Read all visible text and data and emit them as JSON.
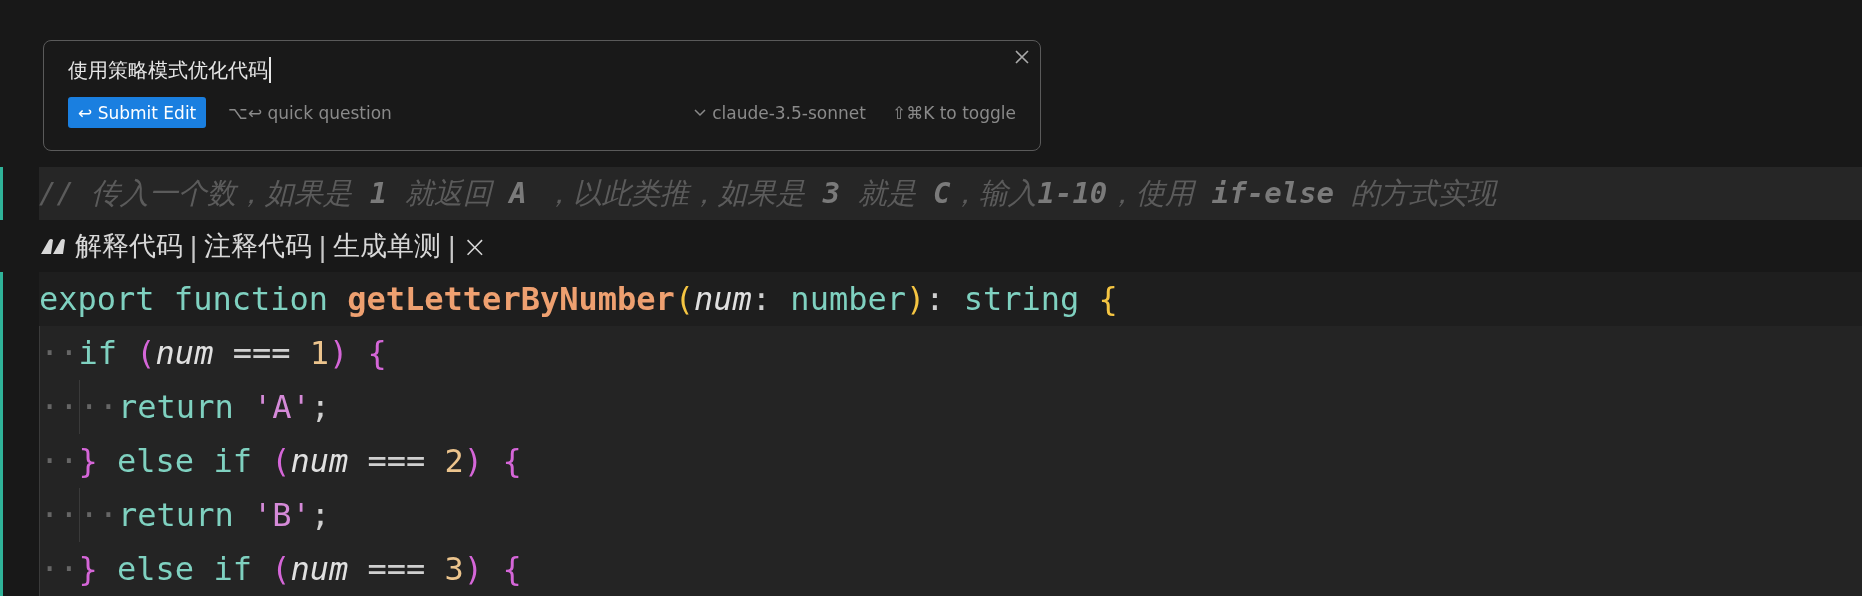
{
  "prompt_box": {
    "value": "使用策略模式优化代码",
    "submit_button": {
      "icon": "↩",
      "label": "Submit Edit"
    },
    "quick_question": "⌥↩ quick question",
    "model": "claude-3.5-sonnet",
    "toggle_hint": "⇧⌘K to toggle"
  },
  "comment_line": "// 传入一个数，如果是 **1** 就返回 **A** ，以此类推，如果是 **3** 就是 **C**，输入**1-10**，使用 **if-else** 的方式实现",
  "codelens": [
    {
      "kind": "action",
      "text": "解释代码"
    },
    {
      "kind": "separator",
      "text": "|"
    },
    {
      "kind": "action",
      "text": "注释代码"
    },
    {
      "kind": "separator",
      "text": "|"
    },
    {
      "kind": "action",
      "text": "生成单测"
    },
    {
      "kind": "separator",
      "text": "|"
    },
    {
      "kind": "close",
      "text": "×"
    }
  ],
  "code_lines": [
    [
      {
        "kind": "keyword",
        "text": "export function "
      },
      {
        "kind": "function",
        "text": "getLetterByNumber"
      },
      {
        "kind": "bracket1",
        "text": "("
      },
      {
        "kind": "param",
        "text": "num"
      },
      {
        "kind": "plain",
        "text": ": "
      },
      {
        "kind": "keyword",
        "text": "number"
      },
      {
        "kind": "bracket1",
        "text": ")"
      },
      {
        "kind": "plain",
        "text": ": "
      },
      {
        "kind": "keyword",
        "text": "string "
      },
      {
        "kind": "bracket1",
        "text": "{"
      }
    ],
    [
      {
        "kind": "ws",
        "text": "··"
      },
      {
        "kind": "keyword",
        "text": "if "
      },
      {
        "kind": "bracket2",
        "text": "("
      },
      {
        "kind": "param",
        "text": "num"
      },
      {
        "kind": "plain",
        "text": " === "
      },
      {
        "kind": "number",
        "text": "1"
      },
      {
        "kind": "bracket2",
        "text": ") {"
      }
    ],
    [
      {
        "kind": "ws",
        "text": "··"
      },
      {
        "kind": "ws",
        "text": "··"
      },
      {
        "kind": "keyword",
        "text": "return "
      },
      {
        "kind": "string",
        "text": "'A'"
      },
      {
        "kind": "plain",
        "text": ";"
      }
    ],
    [
      {
        "kind": "ws",
        "text": "··"
      },
      {
        "kind": "bracket2",
        "text": "}"
      },
      {
        "kind": "keyword",
        "text": " else if "
      },
      {
        "kind": "bracket2",
        "text": "("
      },
      {
        "kind": "param",
        "text": "num"
      },
      {
        "kind": "plain",
        "text": " === "
      },
      {
        "kind": "number",
        "text": "2"
      },
      {
        "kind": "bracket2",
        "text": ") {"
      }
    ],
    [
      {
        "kind": "ws",
        "text": "··"
      },
      {
        "kind": "ws",
        "text": "··"
      },
      {
        "kind": "keyword",
        "text": "return "
      },
      {
        "kind": "string",
        "text": "'B'"
      },
      {
        "kind": "plain",
        "text": ";"
      }
    ],
    [
      {
        "kind": "ws",
        "text": "··"
      },
      {
        "kind": "bracket2",
        "text": "}"
      },
      {
        "kind": "keyword",
        "text": " else if "
      },
      {
        "kind": "bracket2",
        "text": "("
      },
      {
        "kind": "param",
        "text": "num"
      },
      {
        "kind": "plain",
        "text": " === "
      },
      {
        "kind": "number",
        "text": "3"
      },
      {
        "kind": "bracket2",
        "text": ") {"
      }
    ]
  ]
}
